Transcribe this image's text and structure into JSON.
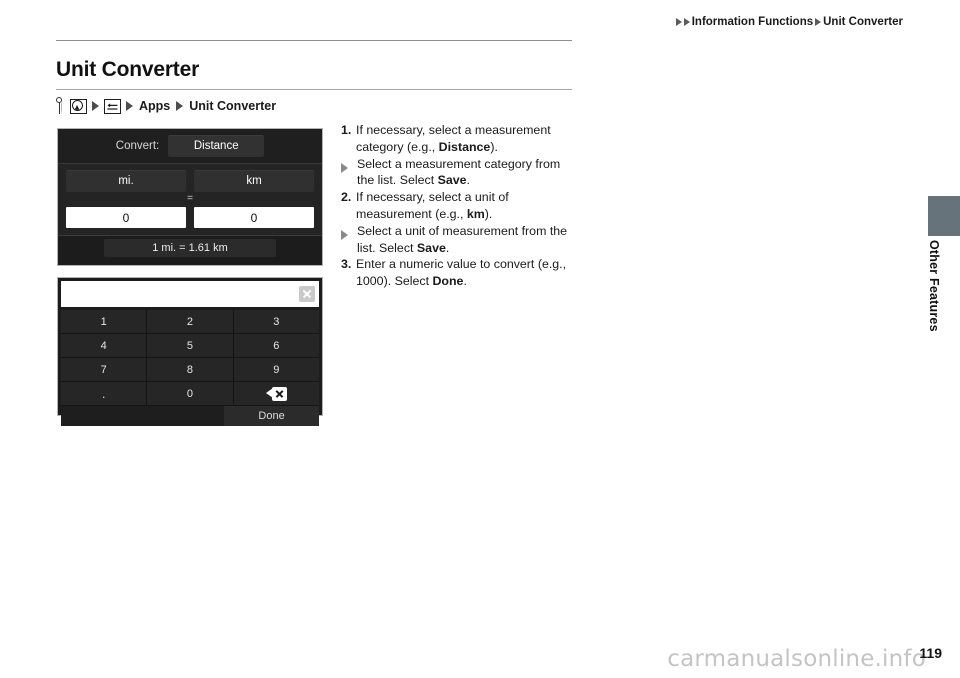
{
  "header": {
    "arrow_icon": "triangle-right-icon",
    "crumb1": "Information Functions",
    "crumb2": "Unit Converter"
  },
  "title": "Unit Converter",
  "nav_path": {
    "icons": [
      "key-icon",
      "home-button-icon",
      "back-arrow-icon"
    ],
    "segment1": "Apps",
    "segment2": "Unit Converter"
  },
  "converter_screen": {
    "convert_label": "Convert:",
    "category_value": "Distance",
    "unit_from": "mi.",
    "unit_to": "km",
    "equals_sign": "=",
    "value_from": "0",
    "value_to": "0",
    "rate_text": "1 mi. = 1.61 km"
  },
  "keypad_screen": {
    "input_value": "",
    "clear_icon": "close-x-icon",
    "keys": [
      [
        "1",
        "2",
        "3"
      ],
      [
        "4",
        "5",
        "6"
      ],
      [
        "7",
        "8",
        "9"
      ]
    ],
    "key_dot": ".",
    "key_zero": "0",
    "backspace_icon": "backspace-icon",
    "done_label": "Done"
  },
  "instructions": {
    "step1": {
      "num": "1.",
      "text_a": "If necessary, select a measurement category (e.g., ",
      "emph": "Distance",
      "text_b": ").",
      "bullet_a": "Select a measurement category from the list. Select ",
      "bullet_emph": "Save",
      "bullet_b": "."
    },
    "step2": {
      "num": "2.",
      "text_a": "If necessary, select a unit of measurement (e.g., ",
      "emph": "km",
      "text_b": ").",
      "bullet_a": "Select a unit of measurement from the list. Select ",
      "bullet_emph": "Save",
      "bullet_b": "."
    },
    "step3": {
      "num": "3.",
      "text_a": "Enter a numeric value to convert (e.g., 1000). Select ",
      "emph": "Done",
      "text_b": "."
    }
  },
  "side_tab": {
    "label": "Other Features",
    "color": "#67737b"
  },
  "footer": {
    "watermark": "carmanualsonline.info",
    "page_number": "119"
  }
}
